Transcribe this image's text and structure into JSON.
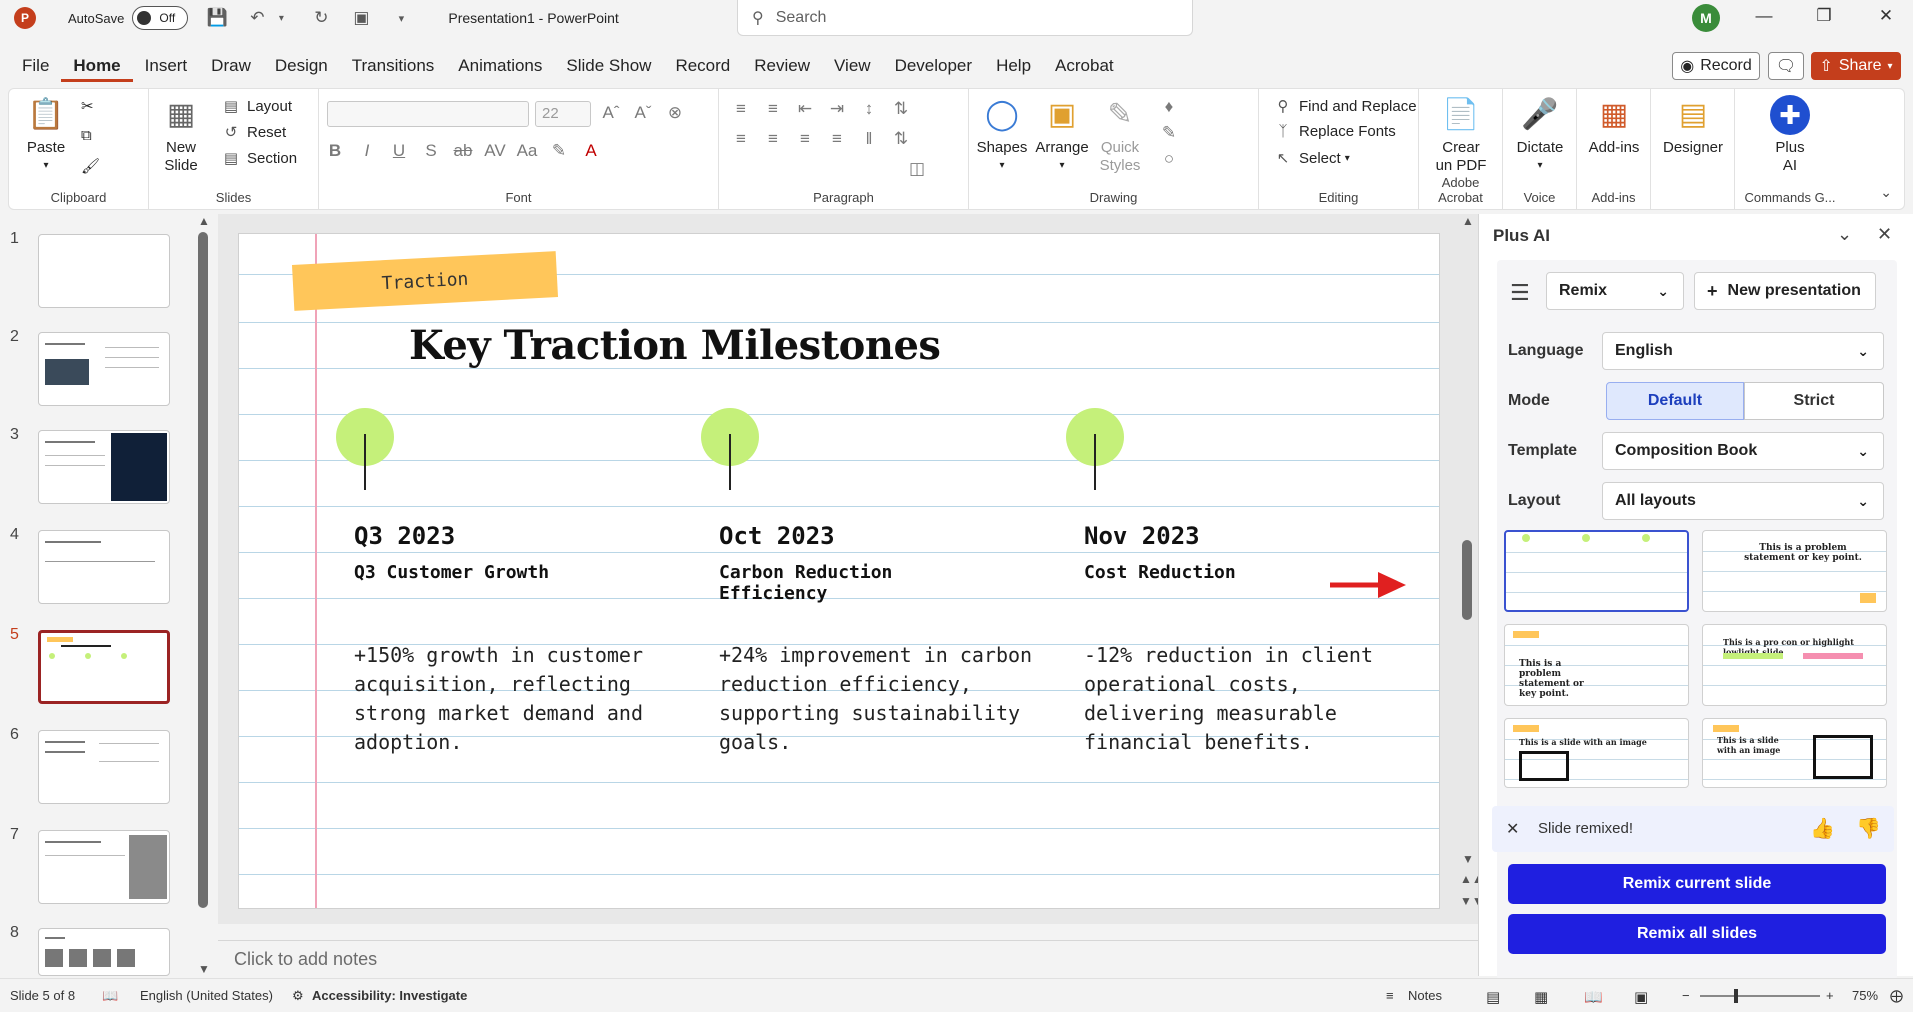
{
  "titlebar": {
    "app_logo": "P",
    "autosave_label": "AutoSave",
    "autosave_state": "Off",
    "document_title": "Presentation1  -  PowerPoint",
    "search_placeholder": "Search",
    "user_initial": "M"
  },
  "menu": {
    "tabs": [
      "File",
      "Home",
      "Insert",
      "Draw",
      "Design",
      "Transitions",
      "Animations",
      "Slide Show",
      "Record",
      "Review",
      "View",
      "Developer",
      "Help",
      "Acrobat"
    ],
    "active_tab": "Home",
    "record_label": "Record",
    "share_label": "Share"
  },
  "ribbon": {
    "clipboard": {
      "paste": "Paste",
      "label": "Clipboard"
    },
    "slides": {
      "new_slide_line1": "New",
      "new_slide_line2": "Slide",
      "layout": "Layout",
      "reset": "Reset",
      "section": "Section",
      "label": "Slides"
    },
    "font": {
      "size": "22",
      "label": "Font"
    },
    "paragraph": {
      "label": "Paragraph"
    },
    "drawing": {
      "shapes": "Shapes",
      "arrange": "Arrange",
      "quick_styles_line1": "Quick",
      "quick_styles_line2": "Styles",
      "label": "Drawing"
    },
    "editing": {
      "find_replace": "Find and Replace",
      "replace_fonts": "Replace Fonts",
      "select": "Select",
      "label": "Editing"
    },
    "acrobat": {
      "line1": "Crear",
      "line2": "un PDF",
      "label": "Adobe Acrobat"
    },
    "voice": {
      "dictate": "Dictate",
      "label": "Voice"
    },
    "addins": {
      "addins": "Add-ins",
      "label": "Add-ins"
    },
    "designer": {
      "designer": "Designer"
    },
    "plusai": {
      "line1": "Plus",
      "line2": "AI",
      "label": "Commands G..."
    }
  },
  "thumbnails": {
    "numbers": [
      "1",
      "2",
      "3",
      "4",
      "5",
      "6",
      "7",
      "8"
    ],
    "active": 5
  },
  "slide": {
    "tag": "Traction",
    "title": "Key Traction Milestones",
    "milestones": [
      {
        "date": "Q3 2023",
        "heading": "Q3 Customer Growth",
        "body": "+150% growth in customer acquisition, reflecting strong market demand and adoption."
      },
      {
        "date": "Oct 2023",
        "heading": "Carbon Reduction Efficiency",
        "body": "+24% improvement in carbon reduction efficiency, supporting sustainability goals."
      },
      {
        "date": "Nov 2023",
        "heading": "Cost Reduction",
        "body": "-12% reduction in client operational costs, delivering measurable financial benefits."
      }
    ],
    "dot_color": "#c5f07a",
    "tag_color": "#ffc65a"
  },
  "notes": {
    "placeholder": "Click to add notes"
  },
  "panel": {
    "title": "Plus AI",
    "mode_select": "Remix",
    "new_presentation": "New presentation",
    "language_label": "Language",
    "language_value": "English",
    "mode_label": "Mode",
    "mode_default": "Default",
    "mode_strict": "Strict",
    "template_label": "Template",
    "template_value": "Composition Book",
    "layout_label": "Layout",
    "layout_value": "All layouts",
    "templates": [
      {
        "title": ""
      },
      {
        "title": "This is a problem statement or key point."
      },
      {
        "title": "This is a problem statement or key point."
      },
      {
        "title": "This is a pro con or highlight lowlight slide"
      },
      {
        "title": "This is a slide with an image"
      },
      {
        "title": "This is a slide with an image"
      }
    ],
    "remixed_message": "Slide remixed!",
    "remix_current": "Remix current slide",
    "remix_all": "Remix all slides",
    "accent_color": "#1f1fe0"
  },
  "statusbar": {
    "slide_count": "Slide 5 of 8",
    "language": "English (United States)",
    "accessibility": "Accessibility: Investigate",
    "notes": "Notes",
    "zoom": "75%"
  }
}
